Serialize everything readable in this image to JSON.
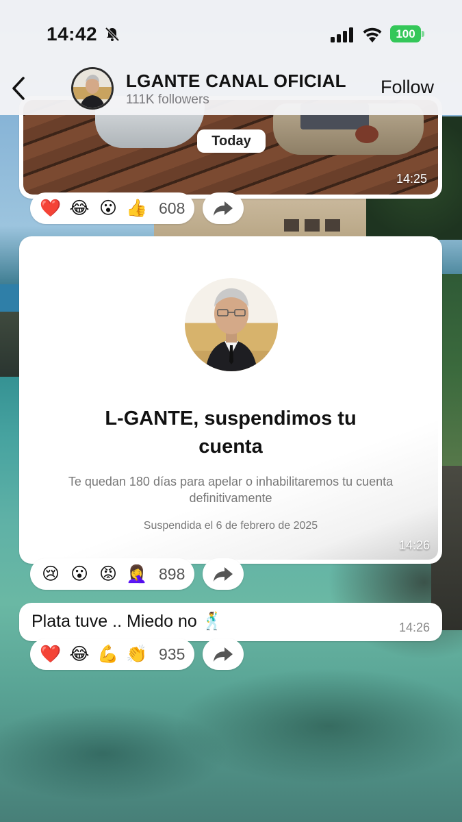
{
  "status_bar": {
    "time": "14:42",
    "battery": "100",
    "icons": [
      "bell-slash-icon",
      "cellular-signal-icon",
      "wifi-icon",
      "battery-icon"
    ],
    "battery_color": "#34c759"
  },
  "header": {
    "channel_name": "LGANTE CANAL OFICIAL",
    "followers": "111K followers",
    "follow_label": "Follow"
  },
  "date_pill": "Today",
  "messages": [
    {
      "type": "image",
      "time": "14:25",
      "reactions": [
        "❤️",
        "😂",
        "😮",
        "👍"
      ],
      "reaction_count": "608"
    },
    {
      "type": "card",
      "title": "L-GANTE, suspendimos tu cuenta",
      "subtitle": "Te quedan 180 días para apelar o inhabilitaremos tu cuenta definitivamente",
      "suspended_date": "Suspendida el 6 de febrero de 2025",
      "time": "14:26",
      "reactions": [
        "😢",
        "😮",
        "😡",
        "🤦‍♀️"
      ],
      "reaction_count": "898"
    },
    {
      "type": "text",
      "text": "Plata tuve .. Miedo no 🕺",
      "time": "14:26",
      "reactions": [
        "❤️",
        "😂",
        "💪",
        "👏"
      ],
      "reaction_count": "935"
    }
  ]
}
